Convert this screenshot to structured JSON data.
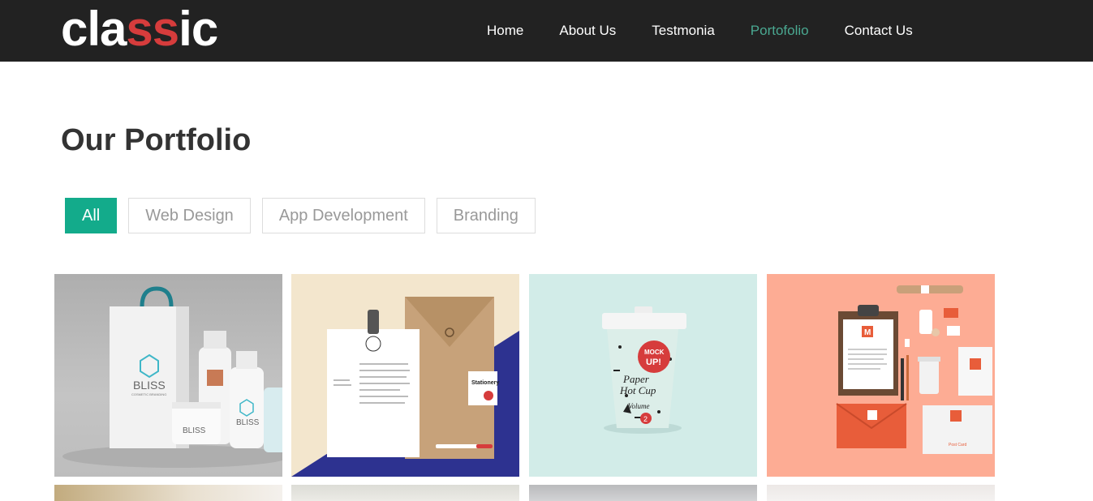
{
  "logo": {
    "part1": "cla",
    "part2": "ss",
    "part3": "ic"
  },
  "nav": {
    "items": [
      {
        "label": "Home"
      },
      {
        "label": "About Us"
      },
      {
        "label": "Testmonia"
      },
      {
        "label": "Portofolio"
      },
      {
        "label": "Contact Us"
      }
    ]
  },
  "portfolio": {
    "title": "Our Portfolio",
    "filters": [
      {
        "label": "All"
      },
      {
        "label": "Web Design"
      },
      {
        "label": "App Development"
      },
      {
        "label": "Branding"
      }
    ],
    "items": [
      {
        "icon": "bliss-cosmetics-image",
        "brand": "BLISS",
        "sub": "COSMETIC BRANDING"
      },
      {
        "icon": "stationery-mockup-image",
        "tag": "Stationery"
      },
      {
        "icon": "paper-cup-mockup-image",
        "line1": "MOCK",
        "line2": "UP!",
        "line3": "Paper",
        "line4": "Hot Cup",
        "line5": "Volume",
        "line6": "2"
      },
      {
        "icon": "branding-mockup-image",
        "mark": "M",
        "card": "Post Card"
      }
    ]
  },
  "colors": {
    "navbar": "#222222",
    "accent_logo": "#d63c3c",
    "nav_active": "#4aa891",
    "filter_active": "#13ab8b"
  }
}
